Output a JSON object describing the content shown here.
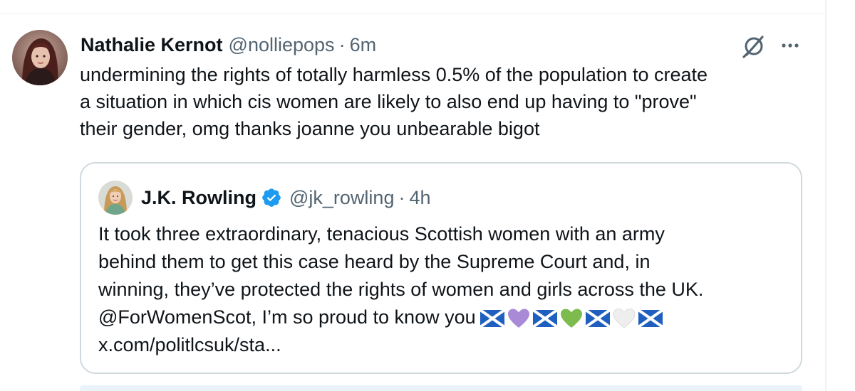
{
  "tweet": {
    "author": {
      "name": "Nathalie Kernot",
      "handle": "@nolliepops",
      "separator": "·",
      "time": "6m"
    },
    "text_lines": [
      "undermining the rights of totally harmless 0.5% of the population to create",
      "a situation in which cis women are likely to also end up having to \"prove\"",
      "their gender, omg thanks joanne you unbearable bigot"
    ],
    "icons": {
      "grok": "grok-icon",
      "more": "more-options-icon"
    }
  },
  "quote": {
    "author": {
      "name": "J.K. Rowling",
      "handle": "@jk_rowling",
      "separator": "·",
      "time": "4h",
      "verified_color": "#1d9bf0"
    },
    "text_lines": [
      "It took three extraordinary, tenacious Scottish women with an army",
      "behind them to get this case heard by the Supreme Court and, in",
      "winning, they’ve protected the rights of women and girls across the UK.",
      "@ForWomenScot, I’m so proud to know you",
      "x.com/politlcsuk/sta..."
    ],
    "emojis": [
      "scotland-flag",
      "purple-heart",
      "scotland-flag",
      "green-heart",
      "scotland-flag",
      "white-heart",
      "scotland-flag"
    ]
  },
  "colors": {
    "text": "#0f1419",
    "secondary": "#536471",
    "border": "#cfd9de",
    "accent": "#1d9bf0"
  }
}
